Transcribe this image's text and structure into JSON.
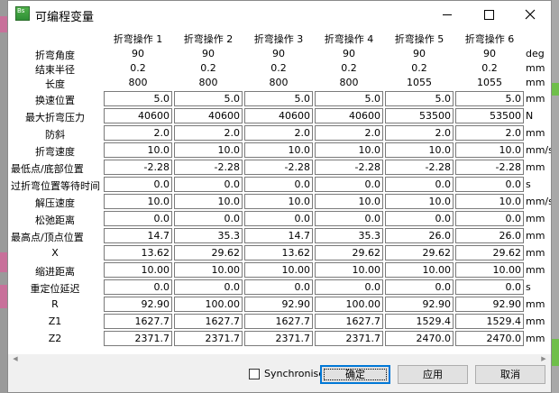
{
  "window": {
    "title": "可编程变量",
    "icon_text": "Bs",
    "minimize_icon": "minimize-icon",
    "maximize_icon": "maximize-icon",
    "close_icon": "close-icon"
  },
  "columns": [
    "折弯操作 1",
    "折弯操作 2",
    "折弯操作 3",
    "折弯操作 4",
    "折弯操作 5",
    "折弯操作 6"
  ],
  "static_rows": [
    {
      "label": "折弯角度",
      "unit": "deg",
      "values": [
        "90",
        "90",
        "90",
        "90",
        "90",
        "90"
      ]
    },
    {
      "label": "结束半径",
      "unit": "mm",
      "values": [
        "0.2",
        "0.2",
        "0.2",
        "0.2",
        "0.2",
        "0.2"
      ]
    },
    {
      "label": "长度",
      "unit": "mm",
      "values": [
        "800",
        "800",
        "800",
        "800",
        "1055",
        "1055"
      ]
    }
  ],
  "edit_rows": [
    {
      "label": "换速位置",
      "unit": "mm",
      "values": [
        "5.0",
        "5.0",
        "5.0",
        "5.0",
        "5.0",
        "5.0"
      ]
    },
    {
      "label": "最大折弯压力",
      "unit": "N",
      "values": [
        "40600",
        "40600",
        "40600",
        "40600",
        "53500",
        "53500"
      ]
    },
    {
      "label": "防斜",
      "unit": "mm",
      "values": [
        "2.0",
        "2.0",
        "2.0",
        "2.0",
        "2.0",
        "2.0"
      ]
    },
    {
      "label": "折弯速度",
      "unit": "mm/s",
      "values": [
        "10.0",
        "10.0",
        "10.0",
        "10.0",
        "10.0",
        "10.0"
      ]
    },
    {
      "label": "最低点/底部位置",
      "unit": "mm",
      "values": [
        "-2.28",
        "-2.28",
        "-2.28",
        "-2.28",
        "-2.28",
        "-2.28"
      ]
    },
    {
      "label": "过折弯位置等待时间",
      "unit": "s",
      "values": [
        "0.0",
        "0.0",
        "0.0",
        "0.0",
        "0.0",
        "0.0"
      ]
    },
    {
      "label": "解压速度",
      "unit": "mm/s",
      "values": [
        "10.0",
        "10.0",
        "10.0",
        "10.0",
        "10.0",
        "10.0"
      ]
    },
    {
      "label": "松弛距离",
      "unit": "mm",
      "values": [
        "0.0",
        "0.0",
        "0.0",
        "0.0",
        "0.0",
        "0.0"
      ]
    },
    {
      "label": "最高点/顶点位置",
      "unit": "mm",
      "values": [
        "14.7",
        "35.3",
        "14.7",
        "35.3",
        "26.0",
        "26.0"
      ]
    },
    {
      "label": "X",
      "unit": "mm",
      "values": [
        "13.62",
        "29.62",
        "13.62",
        "29.62",
        "29.62",
        "29.62"
      ]
    },
    {
      "label": "缩进距离",
      "unit": "mm",
      "values": [
        "10.00",
        "10.00",
        "10.00",
        "10.00",
        "10.00",
        "10.00"
      ]
    },
    {
      "label": "重定位延迟",
      "unit": "s",
      "values": [
        "0.0",
        "0.0",
        "0.0",
        "0.0",
        "0.0",
        "0.0"
      ]
    },
    {
      "label": "R",
      "unit": "mm",
      "values": [
        "92.90",
        "100.00",
        "92.90",
        "100.00",
        "92.90",
        "92.90"
      ]
    },
    {
      "label": "Z1",
      "unit": "mm",
      "values": [
        "1627.7",
        "1627.7",
        "1627.7",
        "1627.7",
        "1529.4",
        "1529.4"
      ]
    },
    {
      "label": "Z2",
      "unit": "mm",
      "values": [
        "2371.7",
        "2371.7",
        "2371.7",
        "2371.7",
        "2470.0",
        "2470.0"
      ]
    }
  ],
  "footer": {
    "synchronise_label": "Synchronise",
    "synchronise_checked": false,
    "ok_label": "确定",
    "apply_label": "应用",
    "cancel_label": "取消"
  }
}
